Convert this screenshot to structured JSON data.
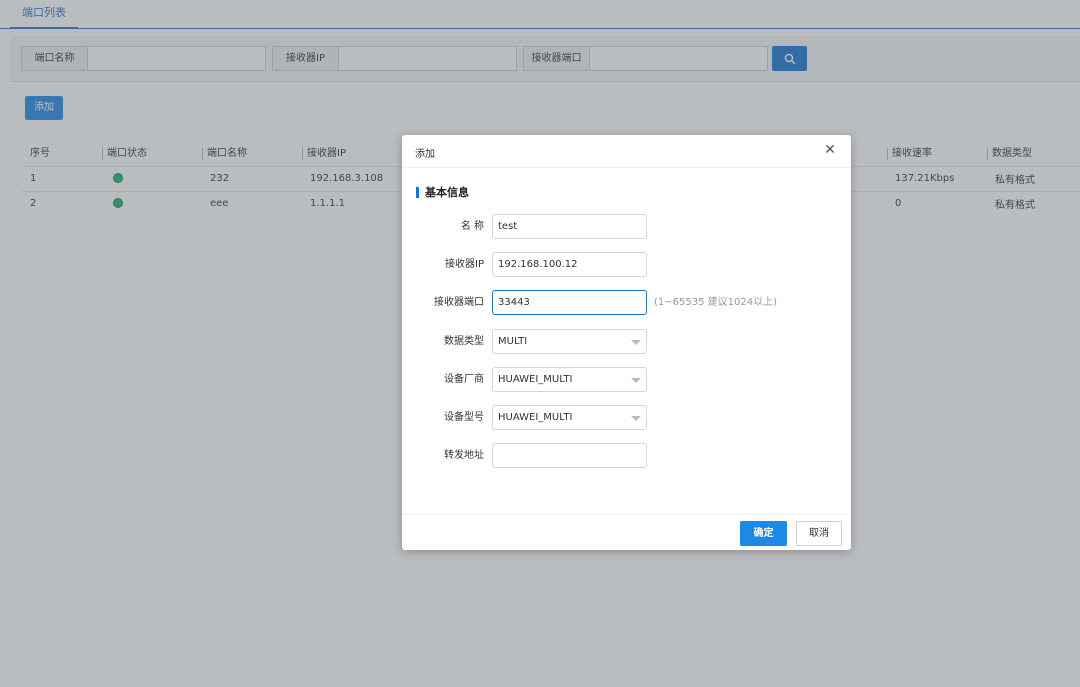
{
  "tab": {
    "label": "端口列表"
  },
  "search": {
    "port_name_label": "端口名称",
    "receiver_ip_label": "接收器IP",
    "receiver_port_label": "接收器端口"
  },
  "toolbar": {
    "add_label": "添加"
  },
  "table": {
    "columns_left": [
      "序号",
      "端口状态",
      "端口名称",
      "接收器IP"
    ],
    "columns_right": [
      "接收速率",
      "数据类型"
    ],
    "rows": [
      {
        "index": "1",
        "name": "232",
        "ip": "192.168.3.108",
        "rate": "137.21Kbps",
        "type": "私有格式"
      },
      {
        "index": "2",
        "name": "eee",
        "ip": "1.1.1.1",
        "rate": "0",
        "type": "私有格式"
      }
    ]
  },
  "modal": {
    "title": "添加",
    "section": "基本信息",
    "fields": {
      "name": {
        "label": "名 称",
        "value": "test"
      },
      "receiver_ip": {
        "label": "接收器IP",
        "value": "192.168.100.12"
      },
      "receiver_port": {
        "label": "接收器端口",
        "value": "33443",
        "hint": "(1~65535 建议1024以上)"
      },
      "data_type": {
        "label": "数据类型",
        "value": "MULTI"
      },
      "vendor": {
        "label": "设备厂商",
        "value": "HUAWEI_MULTI"
      },
      "model": {
        "label": "设备型号",
        "value": "HUAWEI_MULTI"
      },
      "forward": {
        "label": "转发地址",
        "value": ""
      }
    },
    "ok_label": "确定",
    "cancel_label": "取消"
  },
  "colors": {
    "accent": "#1976d2",
    "status_online": "#16b36a"
  }
}
